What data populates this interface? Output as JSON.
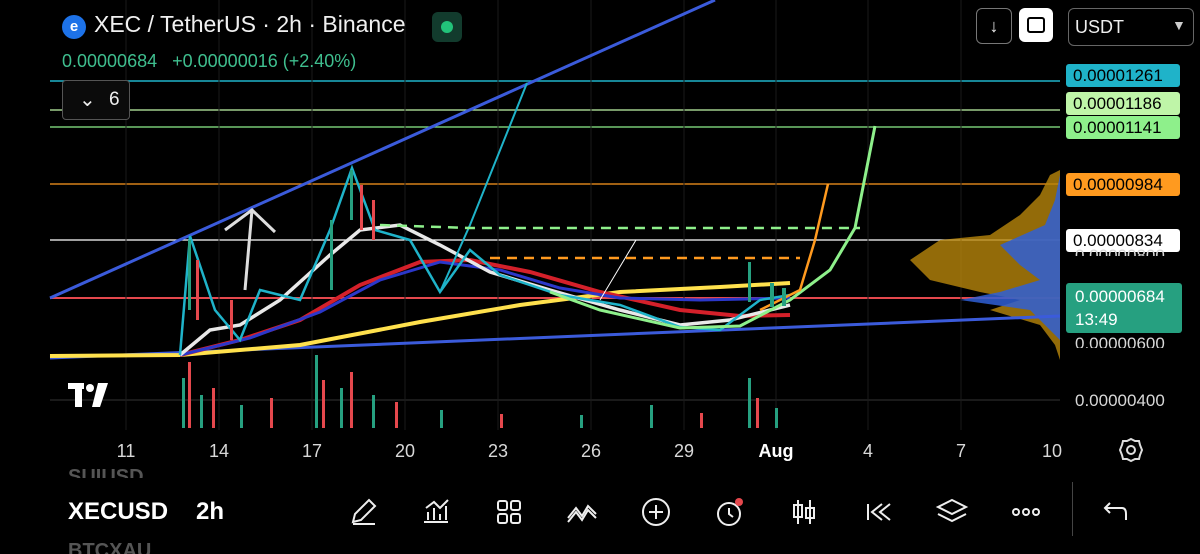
{
  "header": {
    "logo_letter": "e",
    "title": "XEC / TetherUS · 2h · Binance",
    "last_price": "0.00000684",
    "change": "+0.00000016 (+2.40%)",
    "indicators_count": "6",
    "currency": "USDT"
  },
  "price_labels": [
    {
      "value": "0.00001261",
      "bg": "#1fb3c9",
      "fg": "#000000"
    },
    {
      "value": "0.00001186",
      "bg": "#bff5a8",
      "fg": "#000000"
    },
    {
      "value": "0.00001141",
      "bg": "#8ef08b",
      "fg": "#000000"
    },
    {
      "value": "0.00000984",
      "bg": "#ff9a1f",
      "fg": "#000000"
    },
    {
      "value": "0.00000834",
      "bg": "#ffffff",
      "fg": "#000000"
    }
  ],
  "axis_labels": {
    "partial_800": "0.00000800",
    "partial_600": "0.00000600",
    "low_400": "0.00000400"
  },
  "current_price": {
    "price": "0.00000684",
    "countdown": "13:49"
  },
  "x_axis": [
    "11",
    "14",
    "17",
    "20",
    "23",
    "26",
    "29",
    "Aug",
    "4",
    "7",
    "10"
  ],
  "bottom": {
    "symbol": "XECUSD",
    "timeframe": "2h",
    "ghost_top": "SUIUSD",
    "ghost_bottom": "BTCXAU"
  },
  "tools": [
    "pencil-icon",
    "indicators-icon",
    "grid-icon",
    "pattern-icon",
    "add-icon",
    "alert-icon",
    "candles-icon",
    "replay-icon",
    "layers-icon",
    "more-icon",
    "undo-icon"
  ],
  "colors": {
    "channel": "#3b5bdb",
    "up": "#26a080",
    "down": "#e5484d",
    "accent_orange": "#ff9a1f",
    "accent_cyan": "#1fb3c9",
    "accent_green": "#8ef08b"
  }
}
